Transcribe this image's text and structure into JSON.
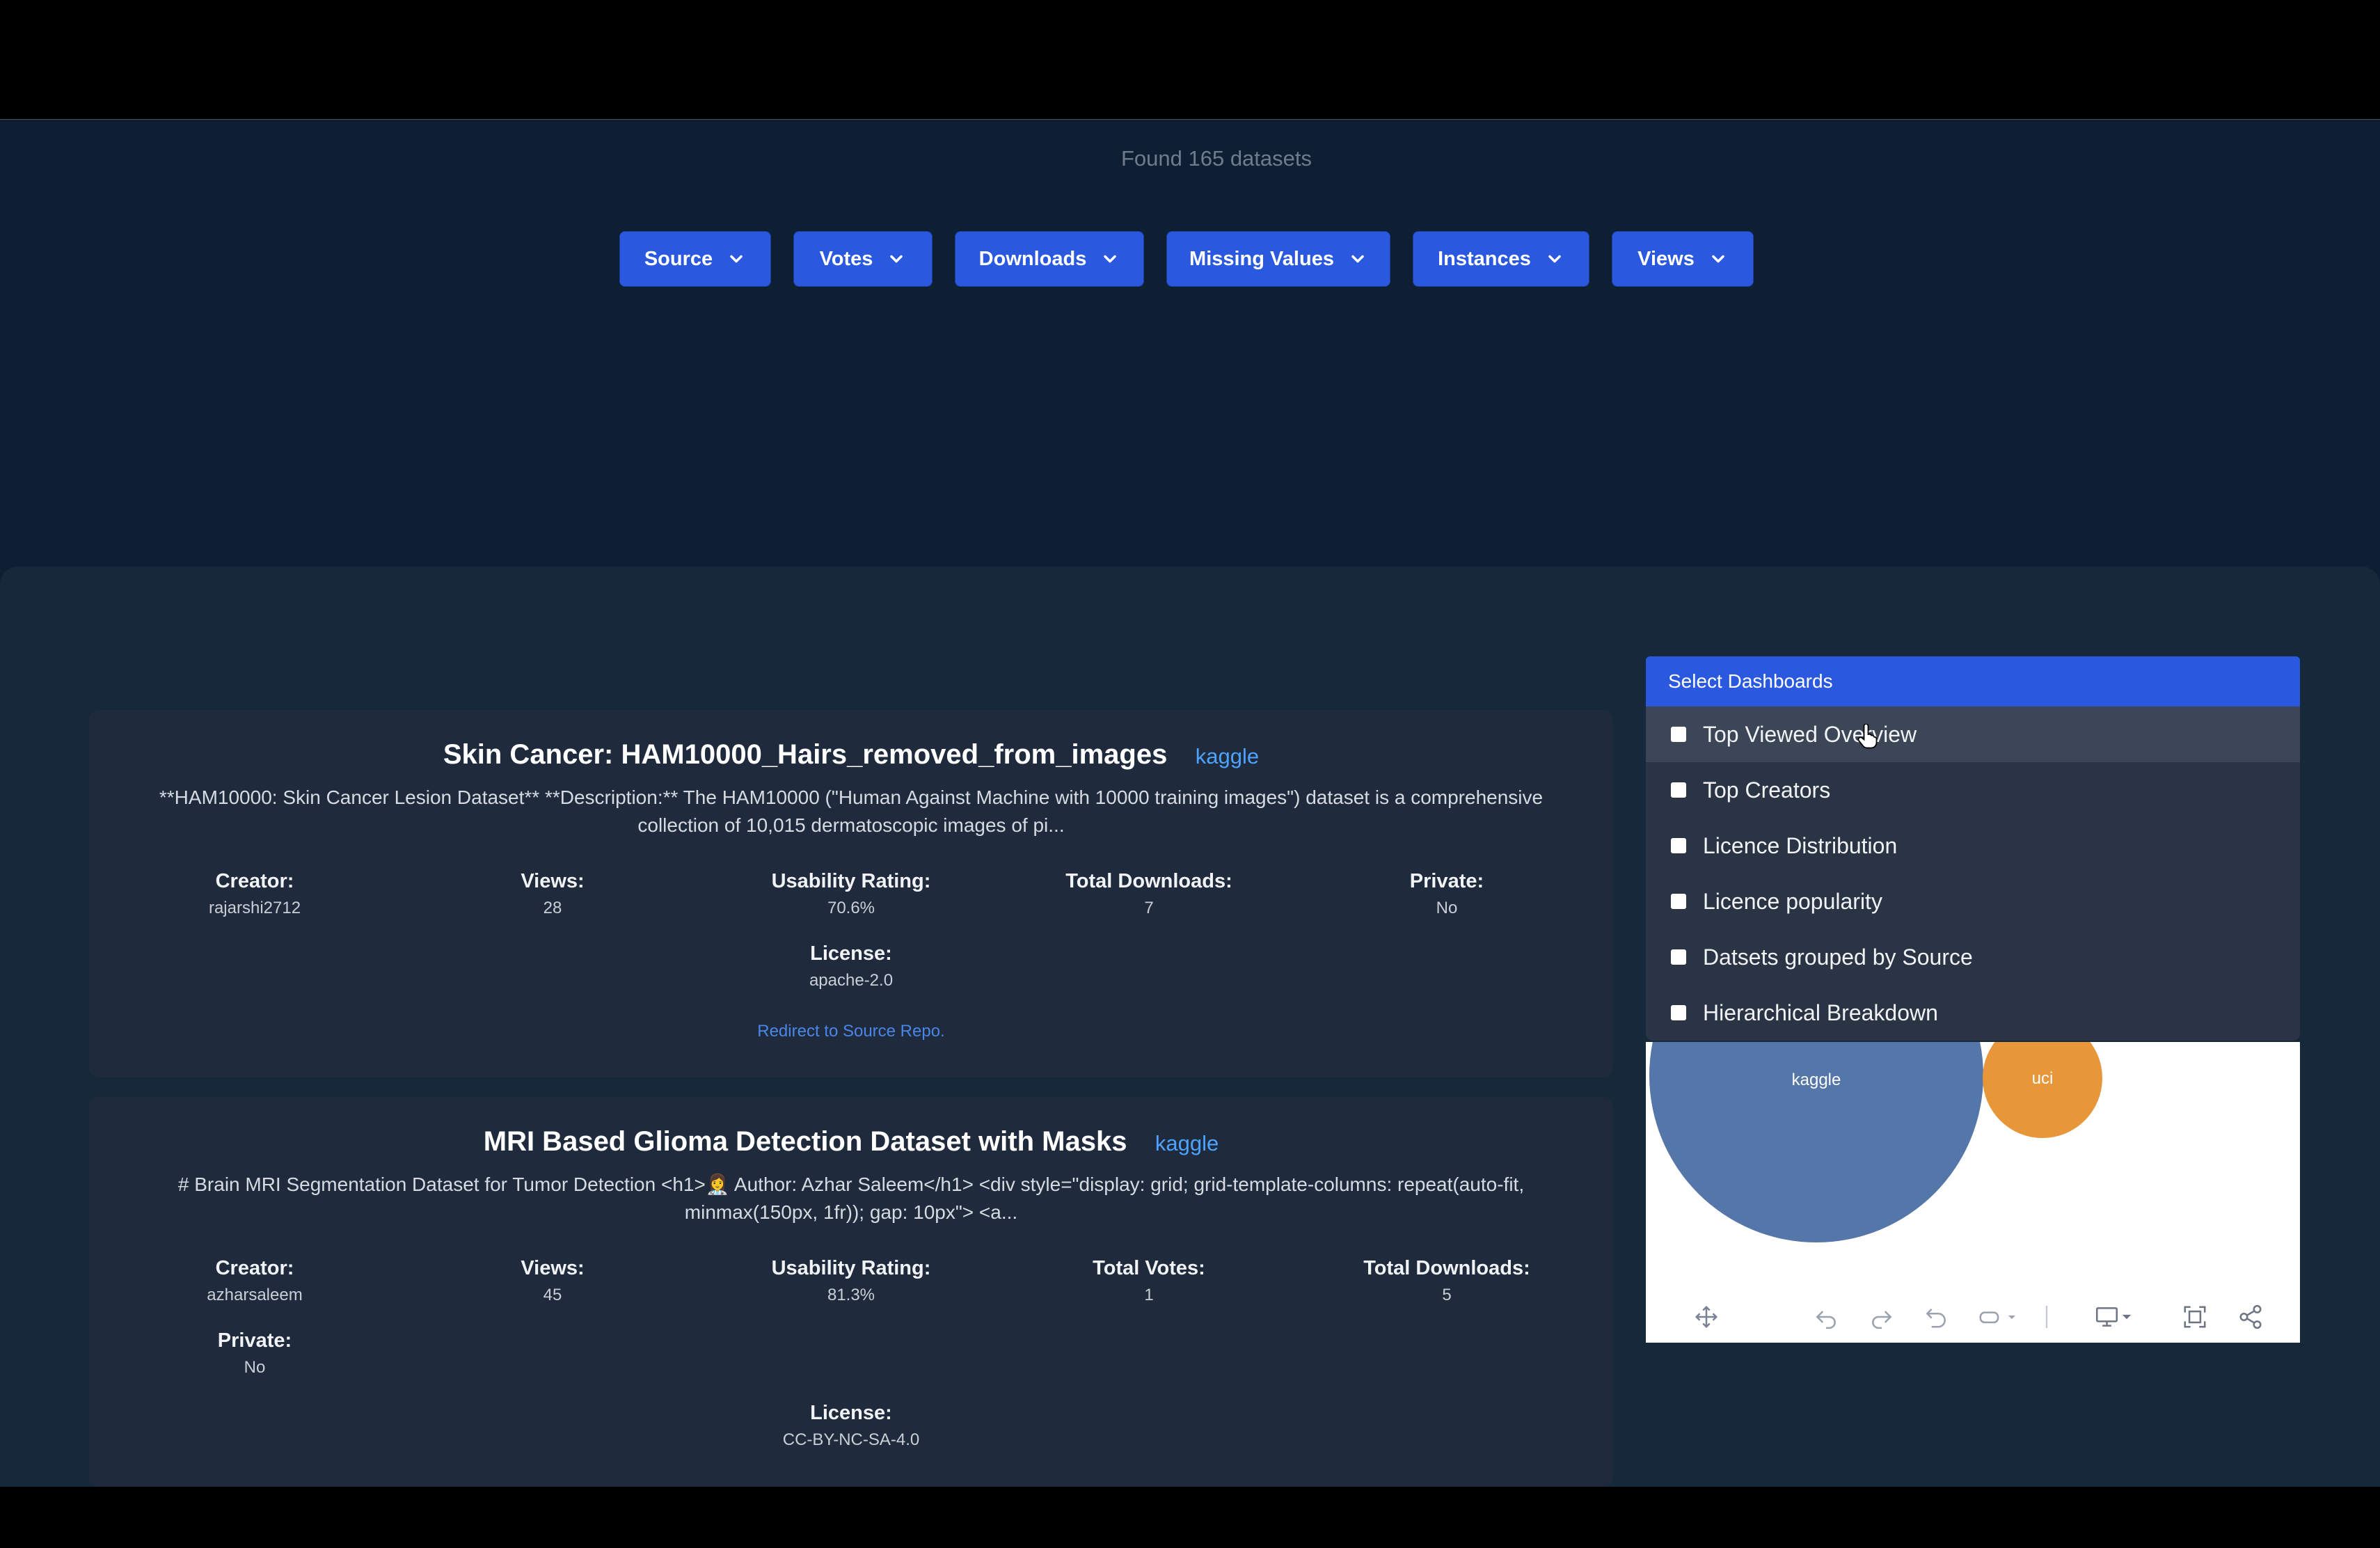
{
  "header": {
    "found_text": "Found 165 datasets"
  },
  "filters": [
    {
      "label": "Source"
    },
    {
      "label": "Votes"
    },
    {
      "label": "Downloads"
    },
    {
      "label": "Missing Values"
    },
    {
      "label": "Instances"
    },
    {
      "label": "Views"
    }
  ],
  "cards": [
    {
      "title": "Skin Cancer: HAM10000_Hairs_removed_from_images",
      "source": "kaggle",
      "description_line1": "**HAM10000: Skin Cancer Lesion Dataset** **Description:** The HAM10000 (\"Human Against Machine with 10000 training images\") dataset is a comprehensive",
      "description_line2": "collection of 10,015 dermatoscopic images of pi...",
      "stats": [
        {
          "label": "Creator:",
          "value": "rajarshi2712"
        },
        {
          "label": "Views:",
          "value": "28"
        },
        {
          "label": "Usability Rating:",
          "value": "70.6%"
        },
        {
          "label": "Total Downloads:",
          "value": "7"
        },
        {
          "label": "Private:",
          "value": "No"
        },
        {
          "label": "License:",
          "value": "apache-2.0"
        }
      ],
      "link": "Redirect to Source Repo."
    },
    {
      "title": "MRI Based Glioma Detection Dataset with Masks",
      "source": "kaggle",
      "description_line1": "# Brain MRI Segmentation Dataset for Tumor Detection <h1>👩‍⚕️ Author: Azhar Saleem</h1> <div style=\"display: grid; grid-template-columns: repeat(auto-fit,",
      "description_line2": "minmax(150px, 1fr)); gap: 10px\"> <a...",
      "stats": [
        {
          "label": "Creator:",
          "value": "azharsaleem"
        },
        {
          "label": "Views:",
          "value": "45"
        },
        {
          "label": "Usability Rating:",
          "value": "81.3%"
        },
        {
          "label": "Total Votes:",
          "value": "1"
        },
        {
          "label": "Total Downloads:",
          "value": "5"
        },
        {
          "label": "Private:",
          "value": "No"
        },
        {
          "label": "License:",
          "value": "CC-BY-NC-SA-4.0"
        }
      ]
    }
  ],
  "dashboards": {
    "header": "Select Dashboards",
    "items": [
      {
        "label": "Top Viewed Overview"
      },
      {
        "label": "Top Creators"
      },
      {
        "label": "Licence Distribution"
      },
      {
        "label": "Licence popularity"
      },
      {
        "label": "Datsets grouped by Source"
      },
      {
        "label": "Hierarchical Breakdown"
      }
    ]
  },
  "chart_data": {
    "type": "bubble",
    "points": [
      {
        "label": "kaggle",
        "color": "#5576a8"
      },
      {
        "label": "uci",
        "color": "#e7963a"
      }
    ]
  },
  "toolbar_icons": [
    "move-icon",
    "undo-icon",
    "redo-icon",
    "reset-icon",
    "rename-icon",
    "chevron-down-icon",
    "download-icon",
    "fullscreen-icon",
    "share-icon"
  ],
  "colors": {
    "accent": "#2a59e0",
    "page_bg": "#0f1f33",
    "card_bg": "#1f2b3c",
    "link": "#4da3ff"
  }
}
